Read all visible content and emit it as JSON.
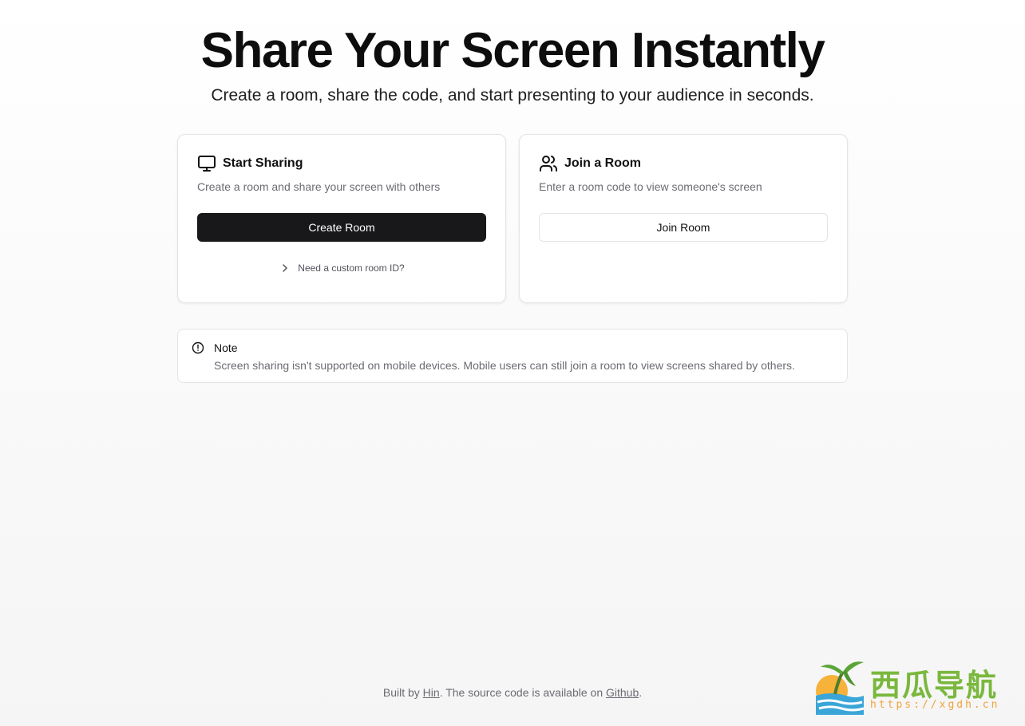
{
  "hero": {
    "title": "Share Your Screen Instantly",
    "subtitle": "Create a room, share the code, and start presenting to your audience in seconds."
  },
  "start_card": {
    "icon": "monitor-icon",
    "title": "Start Sharing",
    "description": "Create a room and share your screen with others",
    "button_label": "Create Room",
    "custom_id_label": "Need a custom room ID?"
  },
  "join_card": {
    "icon": "users-icon",
    "title": "Join a Room",
    "description": "Enter a room code to view someone's screen",
    "button_label": "Join Room"
  },
  "note": {
    "icon": "info-circle-icon",
    "title": "Note",
    "text": "Screen sharing isn't supported on mobile devices. Mobile users can still join a room to view screens shared by others."
  },
  "footer": {
    "prefix": "Built by ",
    "author_link": "Hin",
    "middle": ". The source code is available on ",
    "source_link": "Github",
    "suffix": "."
  },
  "watermark": {
    "name": "西瓜导航",
    "url": "https://xgdh.cn"
  },
  "colors": {
    "primary_button": "#18181b",
    "muted_text": "#6b6b73",
    "border": "#e4e4e7",
    "watermark_green": "#7ab83d",
    "watermark_orange": "#f0a23c"
  }
}
